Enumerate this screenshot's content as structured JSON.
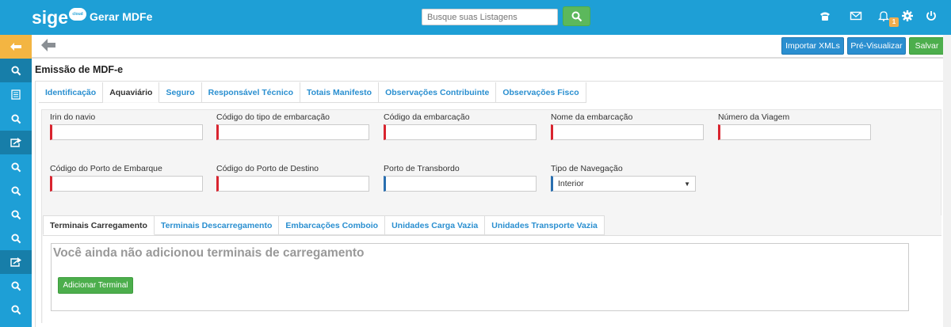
{
  "header": {
    "logo_text": "sige",
    "logo_badge": "cloud",
    "page_title": "Gerar MDFe",
    "search_placeholder": "Busque suas Listagens",
    "notifications_count": "1",
    "icons": [
      "phone-icon",
      "mail-icon",
      "bell-icon",
      "gear-icon",
      "power-icon"
    ]
  },
  "sidebar": {
    "items": [
      "back-arrow-icon",
      "search-icon",
      "document-icon",
      "search-icon",
      "share-icon",
      "search-icon",
      "search-icon",
      "search-icon",
      "search-icon",
      "share-icon",
      "search-icon",
      "search-icon"
    ]
  },
  "toolbar": {
    "import_label": "Importar XMLs",
    "preview_label": "Pré-Visualizar",
    "save_label": "Salvar"
  },
  "form": {
    "title": "Emissão de MDF-e",
    "tabs": [
      "Identificação",
      "Aquaviário",
      "Seguro",
      "Responsável Técnico",
      "Totais Manifesto",
      "Observações Contribuinte",
      "Observações Fisco"
    ],
    "active_tab": "Aquaviário",
    "fields": {
      "irin": {
        "label": "Irin do navio",
        "value": ""
      },
      "tipo_embarcacao": {
        "label": "Código do tipo de embarcação",
        "value": ""
      },
      "codigo_embarcacao": {
        "label": "Código da embarcação",
        "value": ""
      },
      "nome_embarcacao": {
        "label": "Nome da embarcação",
        "value": ""
      },
      "numero_viagem": {
        "label": "Número da Viagem",
        "value": ""
      },
      "porto_embarque": {
        "label": "Código do Porto de Embarque",
        "value": ""
      },
      "porto_destino": {
        "label": "Código do Porto de Destino",
        "value": ""
      },
      "porto_transbordo": {
        "label": "Porto de Transbordo",
        "value": ""
      },
      "tipo_navegacao": {
        "label": "Tipo de Navegação",
        "value": "Interior"
      }
    },
    "subtabs": [
      "Terminais Carregamento",
      "Terminais Descarregamento",
      "Embarcações Comboio",
      "Unidades Carga Vazia",
      "Unidades Transporte Vazia"
    ],
    "active_subtab": "Terminais Carregamento",
    "empty_message": "Você ainda não adicionou terminais de carregamento",
    "add_button_label": "Adicionar Terminal"
  },
  "colors": {
    "brand_blue": "#1e9fd6",
    "accent_orange": "#f3b542",
    "success_green": "#4cae4c",
    "required_red": "#d9242f"
  }
}
